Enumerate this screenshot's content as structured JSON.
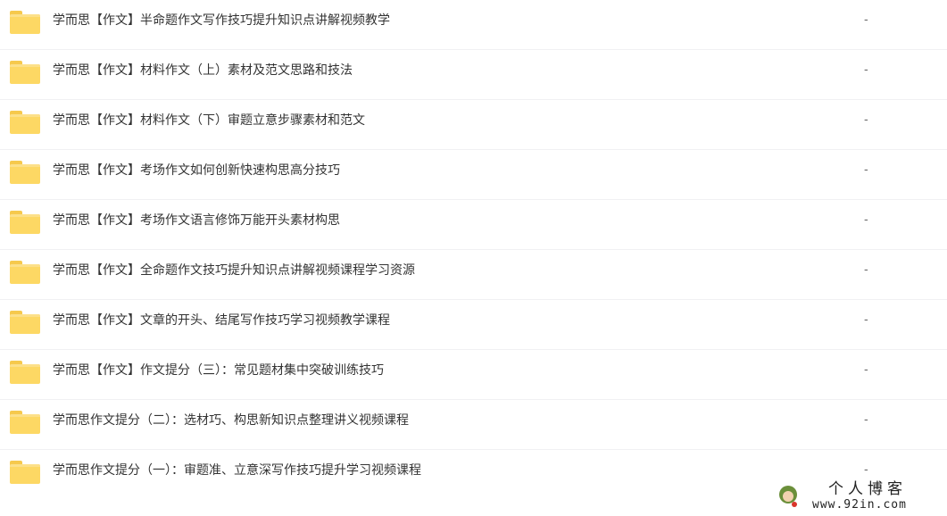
{
  "file_list": {
    "items": [
      {
        "name": "学而思【作文】半命题作文写作技巧提升知识点讲解视频教学",
        "size": "-"
      },
      {
        "name": "学而思【作文】材料作文（上）素材及范文思路和技法",
        "size": "-"
      },
      {
        "name": "学而思【作文】材料作文（下）审题立意步骤素材和范文",
        "size": "-"
      },
      {
        "name": "学而思【作文】考场作文如何创新快速构思高分技巧",
        "size": "-"
      },
      {
        "name": "学而思【作文】考场作文语言修饰万能开头素材构思",
        "size": "-"
      },
      {
        "name": "学而思【作文】全命题作文技巧提升知识点讲解视频课程学习资源",
        "size": "-"
      },
      {
        "name": "学而思【作文】文章的开头、结尾写作技巧学习视频教学课程",
        "size": "-"
      },
      {
        "name": "学而思【作文】作文提分（三）：常见题材集中突破训练技巧",
        "size": "-"
      },
      {
        "name": "学而思作文提分（二）：选材巧、构思新知识点整理讲义视频课程",
        "size": "-"
      },
      {
        "name": "学而思作文提分（一）：审题准、立意深写作技巧提升学习视频课程",
        "size": "-"
      }
    ],
    "icon": "folder-icon",
    "folder_color": "#fdd864"
  },
  "watermark": {
    "title": "个人博客",
    "url": "www.92in.com"
  }
}
